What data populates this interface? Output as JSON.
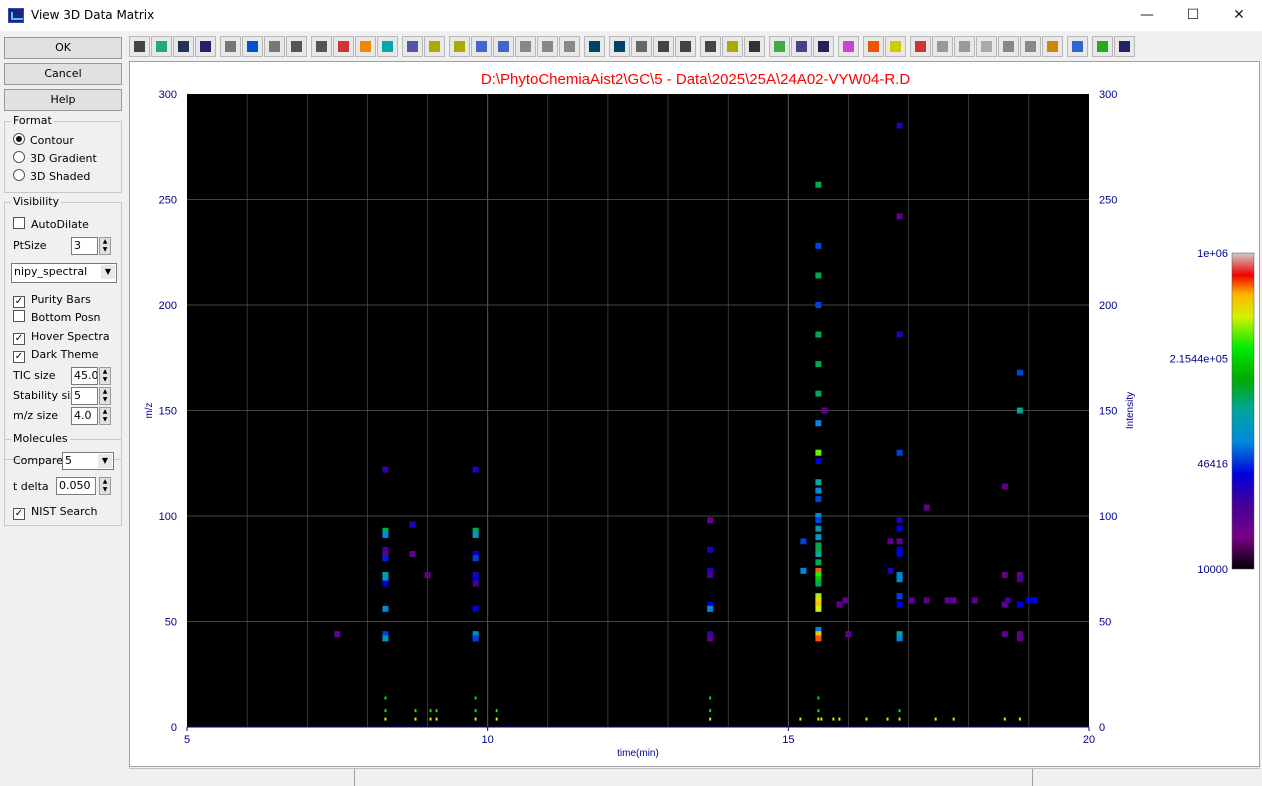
{
  "window": {
    "title": "View 3D Data Matrix",
    "minimize": "—",
    "maximize": "☐",
    "close": "✕"
  },
  "buttons": {
    "ok": "OK",
    "cancel": "Cancel",
    "help": "Help"
  },
  "format": {
    "title": "Format",
    "options": [
      "Contour",
      "3D Gradient",
      "3D Shaded"
    ],
    "selected": "Contour"
  },
  "visibility": {
    "title": "Visibility",
    "autodilate": {
      "label": "AutoDilate",
      "checked": false
    },
    "ptsize_label": "PtSize",
    "ptsize_value": "3",
    "colormap": "nipy_spectral",
    "purity_bars": {
      "label": "Purity Bars",
      "checked": true
    },
    "bottom_posn": {
      "label": "Bottom Posn",
      "checked": false
    },
    "hover_spectra": {
      "label": "Hover Spectra",
      "checked": true
    },
    "dark_theme": {
      "label": "Dark Theme",
      "checked": true
    },
    "tic_size_label": "TIC size",
    "tic_size_value": "45.0",
    "stability_label": "Stability size",
    "stability_value": "5",
    "mz_size_label": "m/z size",
    "mz_size_value": "4.0"
  },
  "molecules": {
    "title": "Molecules",
    "compare_label": "Compare",
    "compare_value": "5",
    "tdelta_label": "t delta",
    "tdelta_value": "0.050",
    "nist": {
      "label": "NIST Search",
      "checked": true
    }
  },
  "toolbar_icons": [
    "print-icon",
    "open-icon",
    "save-icon",
    "w-icon",
    "grid-small-icon",
    "grid-icon",
    "grid-large-icon",
    "zoom-in-icon",
    "zoom-out-icon",
    "spectrum-icon",
    "sphere-icon",
    "wave-icon",
    "peak-icon",
    "tic-icon",
    "tic-bar-icon",
    "line-icon",
    "baseline-icon",
    "hash-icon",
    "person-icon",
    "mountain-icon",
    "move-icon",
    "move-axis-icon",
    "lines-icon",
    "bars-icon",
    "list-icon",
    "list-active-icon",
    "dots-icon",
    "binoculars-icon",
    "filter-icon",
    "calendar-icon",
    "f-icon",
    "color-wheel-icon",
    "rainbow-icon",
    "frame-icon",
    "vertical-bar-icon",
    "refresh-icon",
    "refresh2-icon",
    "window-icon",
    "pin-icon",
    "cloud-icon",
    "colorbar-icon",
    "colorbar2-icon",
    "download-icon",
    "help-icon"
  ],
  "plot": {
    "title": "D:\\PhytoChemiaAist2\\GC\\5 - Data\\2025\\25A\\24A02-VYW04-R.D",
    "background": "#000000",
    "title_color": "#ff0000"
  },
  "chart_data": {
    "type": "heatmap",
    "xlabel": "time(min)",
    "ylabel": "m/z",
    "y2label": "Intensity",
    "xlim": [
      5,
      20
    ],
    "ylim": [
      0,
      300
    ],
    "xticks": [
      5,
      10,
      15,
      20
    ],
    "yticks": [
      0,
      50,
      100,
      150,
      200,
      250,
      300
    ],
    "grid": true,
    "colormap": "nipy_spectral",
    "colorbar": {
      "scale": "log",
      "min": 10000,
      "max": 1000000,
      "tick_labels": [
        "1e+06",
        "2.1544e+05",
        "46416",
        "10000"
      ],
      "tick_values": [
        1000000,
        215440,
        46416,
        10000
      ]
    },
    "points": [
      [
        7.5,
        44,
        0.15
      ],
      [
        8.3,
        93,
        0.55
      ],
      [
        8.3,
        91,
        0.4
      ],
      [
        8.3,
        84,
        0.2
      ],
      [
        8.3,
        82,
        0.15
      ],
      [
        8.3,
        80,
        0.32
      ],
      [
        8.3,
        72,
        0.5
      ],
      [
        8.3,
        70,
        0.45
      ],
      [
        8.3,
        68,
        0.3
      ],
      [
        8.3,
        56,
        0.4
      ],
      [
        8.3,
        44,
        0.35
      ],
      [
        8.3,
        42,
        0.45
      ],
      [
        8.3,
        122,
        0.22
      ],
      [
        8.75,
        96,
        0.25
      ],
      [
        8.75,
        82,
        0.15
      ],
      [
        9.0,
        72,
        0.15
      ],
      [
        9.8,
        93,
        0.55
      ],
      [
        9.8,
        91,
        0.45
      ],
      [
        9.8,
        82,
        0.3
      ],
      [
        9.8,
        80,
        0.35
      ],
      [
        9.8,
        72,
        0.25
      ],
      [
        9.8,
        70,
        0.3
      ],
      [
        9.8,
        68,
        0.2
      ],
      [
        9.8,
        56,
        0.3
      ],
      [
        9.8,
        44,
        0.4
      ],
      [
        9.8,
        42,
        0.35
      ],
      [
        9.8,
        122,
        0.25
      ],
      [
        13.7,
        98,
        0.15
      ],
      [
        13.7,
        84,
        0.25
      ],
      [
        13.7,
        74,
        0.25
      ],
      [
        13.7,
        72,
        0.2
      ],
      [
        13.7,
        58,
        0.3
      ],
      [
        13.7,
        56,
        0.4
      ],
      [
        13.7,
        44,
        0.22
      ],
      [
        13.7,
        42,
        0.15
      ],
      [
        15.5,
        257,
        0.55
      ],
      [
        15.5,
        228,
        0.35
      ],
      [
        15.5,
        214,
        0.55
      ],
      [
        15.5,
        200,
        0.35
      ],
      [
        15.5,
        186,
        0.55
      ],
      [
        15.5,
        172,
        0.55
      ],
      [
        15.5,
        158,
        0.55
      ],
      [
        15.5,
        144,
        0.4
      ],
      [
        15.5,
        130,
        0.75
      ],
      [
        15.5,
        126,
        0.3
      ],
      [
        15.5,
        116,
        0.5
      ],
      [
        15.5,
        112,
        0.4
      ],
      [
        15.5,
        108,
        0.35
      ],
      [
        15.5,
        100,
        0.4
      ],
      [
        15.5,
        98,
        0.35
      ],
      [
        15.5,
        94,
        0.45
      ],
      [
        15.5,
        90,
        0.45
      ],
      [
        15.5,
        86,
        0.55
      ],
      [
        15.5,
        84,
        0.55
      ],
      [
        15.5,
        82,
        0.5
      ],
      [
        15.5,
        78,
        0.55
      ],
      [
        15.5,
        74,
        0.9
      ],
      [
        15.5,
        72,
        0.72
      ],
      [
        15.5,
        70,
        0.65
      ],
      [
        15.5,
        68,
        0.55
      ],
      [
        15.5,
        62,
        0.78
      ],
      [
        15.5,
        60,
        0.82
      ],
      [
        15.5,
        58,
        0.85
      ],
      [
        15.5,
        56,
        0.8
      ],
      [
        15.5,
        46,
        0.4
      ],
      [
        15.5,
        44,
        0.85
      ],
      [
        15.5,
        42,
        0.9
      ],
      [
        15.6,
        150,
        0.15
      ],
      [
        15.25,
        88,
        0.35
      ],
      [
        15.25,
        74,
        0.4
      ],
      [
        15.85,
        58,
        0.15
      ],
      [
        15.95,
        60,
        0.15
      ],
      [
        16.0,
        44,
        0.15
      ],
      [
        16.7,
        88,
        0.15
      ],
      [
        16.7,
        74,
        0.25
      ],
      [
        16.85,
        285,
        0.25
      ],
      [
        16.85,
        242,
        0.15
      ],
      [
        16.85,
        186,
        0.25
      ],
      [
        16.85,
        130,
        0.35
      ],
      [
        16.85,
        98,
        0.25
      ],
      [
        16.85,
        94,
        0.3
      ],
      [
        16.85,
        88,
        0.15
      ],
      [
        16.85,
        84,
        0.3
      ],
      [
        16.85,
        82,
        0.3
      ],
      [
        16.85,
        72,
        0.4
      ],
      [
        16.85,
        70,
        0.4
      ],
      [
        16.85,
        62,
        0.35
      ],
      [
        16.85,
        58,
        0.3
      ],
      [
        16.85,
        44,
        0.5
      ],
      [
        16.85,
        42,
        0.4
      ],
      [
        17.05,
        60,
        0.15
      ],
      [
        17.3,
        104,
        0.15
      ],
      [
        17.3,
        60,
        0.15
      ],
      [
        17.65,
        60,
        0.15
      ],
      [
        17.75,
        60,
        0.15
      ],
      [
        18.1,
        60,
        0.15
      ],
      [
        18.6,
        114,
        0.15
      ],
      [
        18.6,
        72,
        0.15
      ],
      [
        18.6,
        58,
        0.15
      ],
      [
        18.6,
        44,
        0.15
      ],
      [
        18.65,
        60,
        0.2
      ],
      [
        18.85,
        168,
        0.35
      ],
      [
        18.85,
        150,
        0.5
      ],
      [
        18.85,
        72,
        0.15
      ],
      [
        18.85,
        70,
        0.2
      ],
      [
        18.85,
        58,
        0.3
      ],
      [
        18.85,
        44,
        0.15
      ],
      [
        18.85,
        42,
        0.15
      ],
      [
        19.0,
        60,
        0.3
      ],
      [
        19.1,
        60,
        0.3
      ]
    ],
    "stability_marks": [
      [
        8.3,
        14
      ],
      [
        8.3,
        8
      ],
      [
        8.3,
        4
      ],
      [
        8.8,
        8
      ],
      [
        8.8,
        4
      ],
      [
        9.05,
        8
      ],
      [
        9.05,
        4
      ],
      [
        9.15,
        8
      ],
      [
        9.15,
        4
      ],
      [
        9.8,
        14
      ],
      [
        9.8,
        8
      ],
      [
        9.8,
        4
      ],
      [
        10.15,
        8
      ],
      [
        10.15,
        4
      ],
      [
        13.7,
        14
      ],
      [
        13.7,
        8
      ],
      [
        13.7,
        4
      ],
      [
        15.2,
        4
      ],
      [
        15.5,
        14
      ],
      [
        15.5,
        8
      ],
      [
        15.5,
        4
      ],
      [
        15.55,
        4
      ],
      [
        15.75,
        4
      ],
      [
        15.85,
        4
      ],
      [
        16.3,
        4
      ],
      [
        16.65,
        4
      ],
      [
        16.85,
        8
      ],
      [
        16.85,
        4
      ],
      [
        17.45,
        4
      ],
      [
        17.75,
        4
      ],
      [
        18.6,
        4
      ],
      [
        18.85,
        4
      ]
    ]
  }
}
